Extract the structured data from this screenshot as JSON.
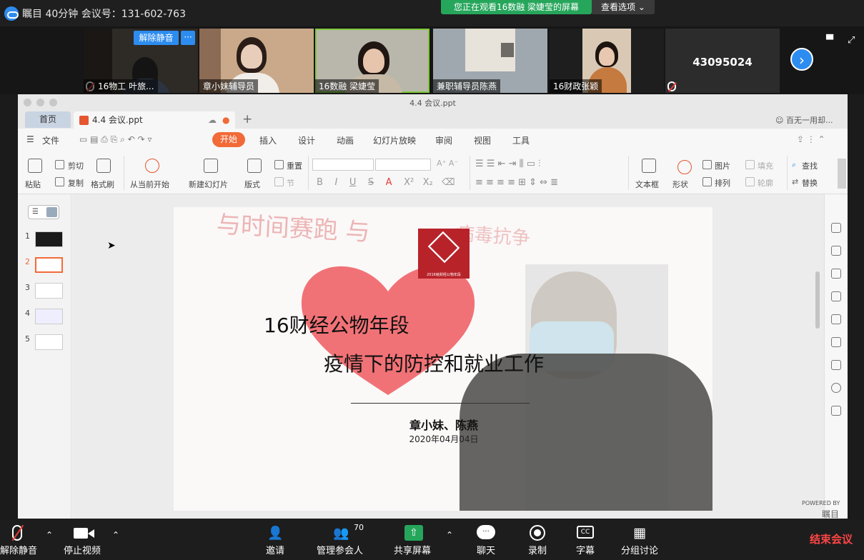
{
  "meeting": {
    "info": "瞩目 40分钟 会议号：131-602-763",
    "viewing_banner": "您正在观看16数融 梁婕莹的屏幕",
    "view_options": "查看选项"
  },
  "participants": [
    {
      "name": "16物工 叶旅...",
      "muted": true
    },
    {
      "name": "章小妹辅导员",
      "muted": false
    },
    {
      "name": "16数融 梁婕莹",
      "muted": false,
      "active": true
    },
    {
      "name": "兼职辅导员陈燕",
      "muted": false
    },
    {
      "name": "16财政张颖",
      "muted": false
    },
    {
      "name": "43095024",
      "muted": true
    }
  ],
  "tile_controls": {
    "unmute": "解除静音",
    "more": "···"
  },
  "ppt": {
    "window_title": "4.4 会议.ppt",
    "home_tab": "首页",
    "file_tab": "4.4 会议.ppt",
    "account": "百无一用却...",
    "menu": [
      "文件",
      "开始",
      "插入",
      "设计",
      "动画",
      "幻灯片放映",
      "审阅",
      "视图",
      "工具"
    ],
    "ribbon": {
      "paste": "粘贴",
      "cut": "剪切",
      "copy": "复制",
      "format_painter": "格式刷",
      "from_current": "从当前开始",
      "new_slide": "新建幻灯片",
      "layout": "版式",
      "reset": "重置",
      "section": "节",
      "textbox": "文本框",
      "shape": "形状",
      "picture": "图片",
      "fill": "填充",
      "arrange": "排列",
      "outline": "轮廓",
      "find": "查找",
      "replace": "替换"
    },
    "slide_numbers": [
      "1",
      "2",
      "3",
      "4",
      "5"
    ]
  },
  "slide": {
    "banner_text": "与时间赛跑 与",
    "banner_text2": "病毒抗争",
    "logo_caption": "2016级财经公物年段",
    "title1": "16财经公物年段",
    "title2": "疫情下的防控和就业工作",
    "authors": "章小妹、陈燕",
    "date": "2020年04月04日"
  },
  "toolbar": {
    "unmute": "解除静音",
    "stop_video": "停止视频",
    "invite": "邀请",
    "manage": "管理参会人",
    "participant_count": "70",
    "share": "共享屏幕",
    "chat": "聊天",
    "record": "录制",
    "captions": "字幕",
    "cc": "CC",
    "breakout": "分组讨论",
    "end": "结束会议"
  },
  "powered_by": "POWERED BY",
  "powered_brand": "瞩目",
  "colors": {
    "accent": "#2d8cf0",
    "green": "#26a65b",
    "ppt_orange": "#f26a38",
    "end_red": "#ff4545"
  }
}
